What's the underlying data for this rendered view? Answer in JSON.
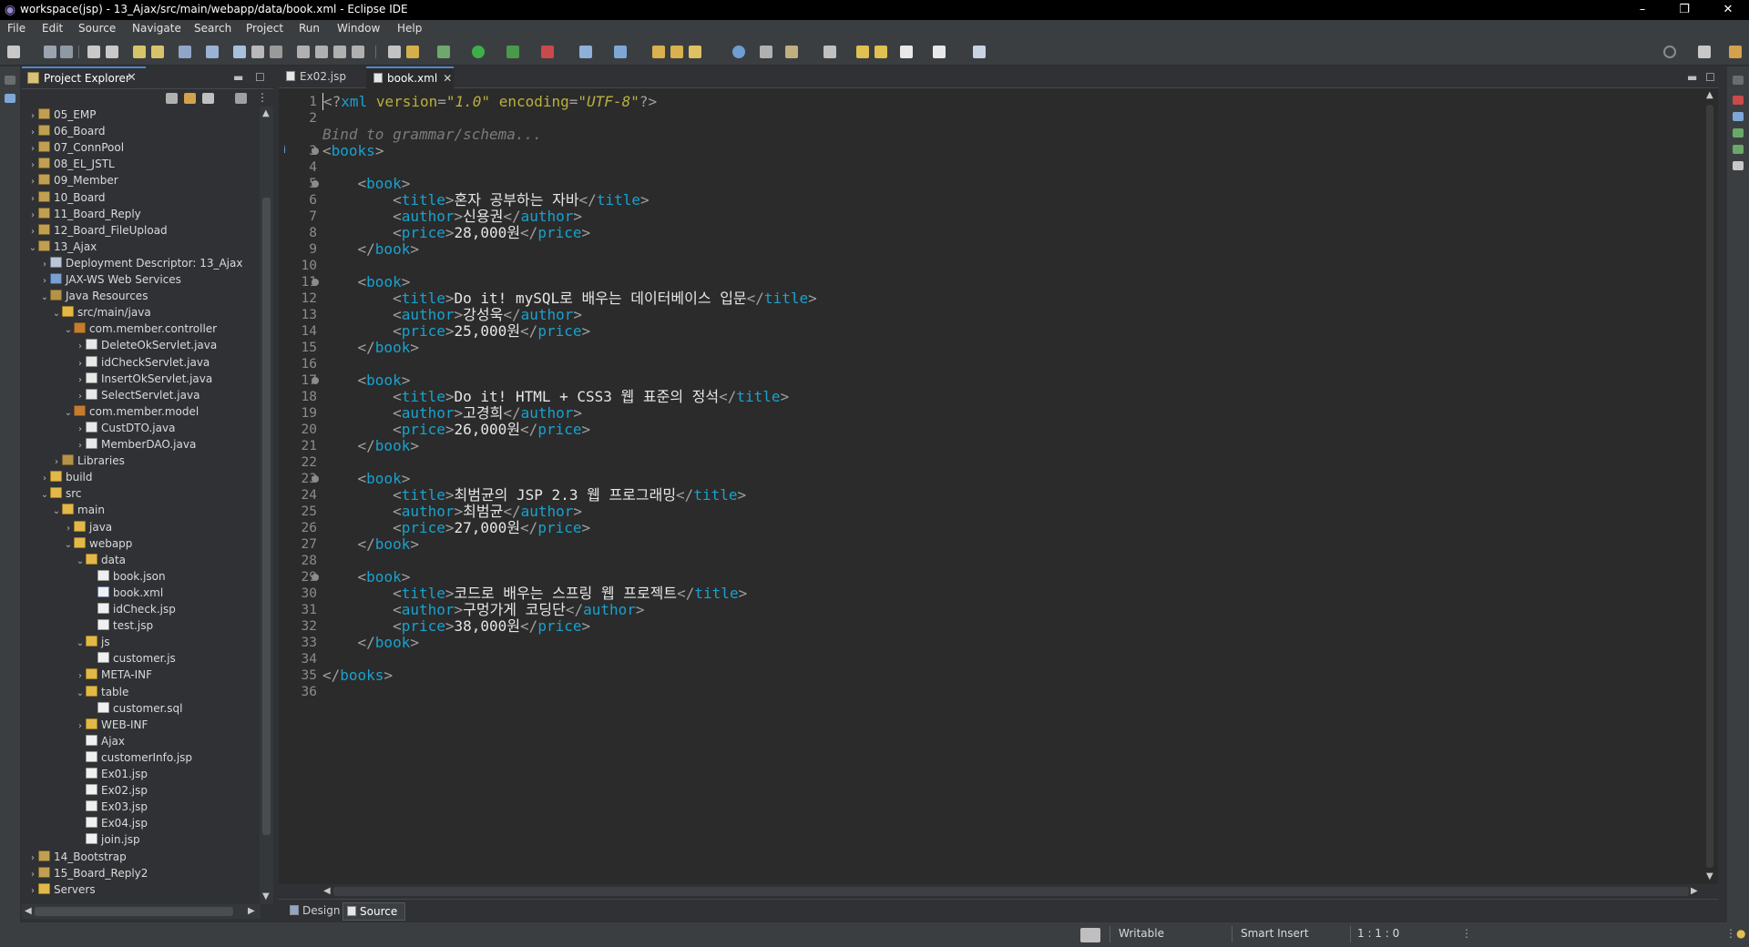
{
  "window": {
    "title": "workspace(jsp) - 13_Ajax/src/main/webapp/data/book.xml - Eclipse IDE",
    "controls": {
      "minimize": "–",
      "restore": "❐",
      "close": "✕"
    }
  },
  "menu": [
    "File",
    "Edit",
    "Source",
    "Navigate",
    "Search",
    "Project",
    "Run",
    "Window",
    "Help"
  ],
  "explorer": {
    "title": "Project Explorer",
    "close": "✕",
    "tree": [
      {
        "label": "05_EMP",
        "depth": 0,
        "arrow": "›",
        "icon": "proj"
      },
      {
        "label": "06_Board",
        "depth": 0,
        "arrow": "›",
        "icon": "proj"
      },
      {
        "label": "07_ConnPool",
        "depth": 0,
        "arrow": "›",
        "icon": "proj"
      },
      {
        "label": "08_EL_JSTL",
        "depth": 0,
        "arrow": "›",
        "icon": "proj"
      },
      {
        "label": "09_Member",
        "depth": 0,
        "arrow": "›",
        "icon": "proj"
      },
      {
        "label": "10_Board",
        "depth": 0,
        "arrow": "›",
        "icon": "proj"
      },
      {
        "label": "11_Board_Reply",
        "depth": 0,
        "arrow": "›",
        "icon": "proj"
      },
      {
        "label": "12_Board_FileUpload",
        "depth": 0,
        "arrow": "›",
        "icon": "proj"
      },
      {
        "label": "13_Ajax",
        "depth": 0,
        "arrow": "⌄",
        "icon": "proj"
      },
      {
        "label": "Deployment Descriptor: 13_Ajax",
        "depth": 1,
        "arrow": "›",
        "icon": "dd"
      },
      {
        "label": "JAX-WS Web Services",
        "depth": 1,
        "arrow": "›",
        "icon": "ws"
      },
      {
        "label": "Java Resources",
        "depth": 1,
        "arrow": "⌄",
        "icon": "lib"
      },
      {
        "label": "src/main/java",
        "depth": 2,
        "arrow": "⌄",
        "icon": "folder"
      },
      {
        "label": "com.member.controller",
        "depth": 3,
        "arrow": "⌄",
        "icon": "pkg"
      },
      {
        "label": "DeleteOkServlet.java",
        "depth": 4,
        "arrow": "›",
        "icon": "java"
      },
      {
        "label": "idCheckServlet.java",
        "depth": 4,
        "arrow": "›",
        "icon": "java"
      },
      {
        "label": "InsertOkServlet.java",
        "depth": 4,
        "arrow": "›",
        "icon": "java"
      },
      {
        "label": "SelectServlet.java",
        "depth": 4,
        "arrow": "›",
        "icon": "java"
      },
      {
        "label": "com.member.model",
        "depth": 3,
        "arrow": "⌄",
        "icon": "pkg"
      },
      {
        "label": "CustDTO.java",
        "depth": 4,
        "arrow": "›",
        "icon": "java"
      },
      {
        "label": "MemberDAO.java",
        "depth": 4,
        "arrow": "›",
        "icon": "java"
      },
      {
        "label": "Libraries",
        "depth": 2,
        "arrow": "›",
        "icon": "lib"
      },
      {
        "label": "build",
        "depth": 1,
        "arrow": "›",
        "icon": "folder"
      },
      {
        "label": "src",
        "depth": 1,
        "arrow": "⌄",
        "icon": "folder"
      },
      {
        "label": "main",
        "depth": 2,
        "arrow": "⌄",
        "icon": "folder"
      },
      {
        "label": "java",
        "depth": 3,
        "arrow": "›",
        "icon": "folder"
      },
      {
        "label": "webapp",
        "depth": 3,
        "arrow": "⌄",
        "icon": "folder"
      },
      {
        "label": "data",
        "depth": 4,
        "arrow": "⌄",
        "icon": "folder"
      },
      {
        "label": "book.json",
        "depth": 5,
        "arrow": "",
        "icon": "file"
      },
      {
        "label": "book.xml",
        "depth": 5,
        "arrow": "",
        "icon": "xml"
      },
      {
        "label": "idCheck.jsp",
        "depth": 5,
        "arrow": "",
        "icon": "file"
      },
      {
        "label": "test.jsp",
        "depth": 5,
        "arrow": "",
        "icon": "file"
      },
      {
        "label": "js",
        "depth": 4,
        "arrow": "⌄",
        "icon": "folder"
      },
      {
        "label": "customer.js",
        "depth": 5,
        "arrow": "",
        "icon": "file"
      },
      {
        "label": "META-INF",
        "depth": 4,
        "arrow": "›",
        "icon": "folder"
      },
      {
        "label": "table",
        "depth": 4,
        "arrow": "⌄",
        "icon": "folder"
      },
      {
        "label": "customer.sql",
        "depth": 5,
        "arrow": "",
        "icon": "file"
      },
      {
        "label": "WEB-INF",
        "depth": 4,
        "arrow": "›",
        "icon": "folder"
      },
      {
        "label": "Ajax",
        "depth": 4,
        "arrow": "",
        "icon": "file"
      },
      {
        "label": "customerInfo.jsp",
        "depth": 4,
        "arrow": "",
        "icon": "file"
      },
      {
        "label": "Ex01.jsp",
        "depth": 4,
        "arrow": "",
        "icon": "file"
      },
      {
        "label": "Ex02.jsp",
        "depth": 4,
        "arrow": "",
        "icon": "file"
      },
      {
        "label": "Ex03.jsp",
        "depth": 4,
        "arrow": "",
        "icon": "file"
      },
      {
        "label": "Ex04.jsp",
        "depth": 4,
        "arrow": "",
        "icon": "file"
      },
      {
        "label": "join.jsp",
        "depth": 4,
        "arrow": "",
        "icon": "file"
      },
      {
        "label": "14_Bootstrap",
        "depth": 0,
        "arrow": "›",
        "icon": "proj"
      },
      {
        "label": "15_Board_Reply2",
        "depth": 0,
        "arrow": "›",
        "icon": "proj"
      },
      {
        "label": "Servers",
        "depth": 0,
        "arrow": "›",
        "icon": "folder"
      }
    ]
  },
  "editor": {
    "tabs": [
      {
        "label": "Ex02.jsp",
        "active": false
      },
      {
        "label": "book.xml",
        "active": true,
        "close": "✕"
      }
    ],
    "hint": "Bind to grammar/schema...",
    "folded_lines": [
      3,
      5,
      11,
      17,
      23,
      29
    ],
    "lines": [
      [
        [
          "br",
          "<?"
        ],
        [
          "pi",
          "xml"
        ],
        [
          "text",
          " "
        ],
        [
          "attr",
          "version"
        ],
        [
          "br",
          "="
        ],
        [
          "val",
          "\"1.0\""
        ],
        [
          "text",
          " "
        ],
        [
          "attr",
          "encoding"
        ],
        [
          "br",
          "="
        ],
        [
          "val",
          "\"UTF-8\""
        ],
        [
          "br",
          "?>"
        ]
      ],
      [],
      [
        [
          "br",
          "<"
        ],
        [
          "tag",
          "books"
        ],
        [
          "br",
          ">"
        ]
      ],
      [],
      [
        [
          "text",
          "    "
        ],
        [
          "br",
          "<"
        ],
        [
          "tag",
          "book"
        ],
        [
          "br",
          ">"
        ]
      ],
      [
        [
          "text",
          "        "
        ],
        [
          "br",
          "<"
        ],
        [
          "tag",
          "title"
        ],
        [
          "br",
          ">"
        ],
        [
          "text",
          "혼자 공부하는 자바"
        ],
        [
          "br",
          "</"
        ],
        [
          "tag",
          "title"
        ],
        [
          "br",
          ">"
        ]
      ],
      [
        [
          "text",
          "        "
        ],
        [
          "br",
          "<"
        ],
        [
          "tag",
          "author"
        ],
        [
          "br",
          ">"
        ],
        [
          "text",
          "신용권"
        ],
        [
          "br",
          "</"
        ],
        [
          "tag",
          "author"
        ],
        [
          "br",
          ">"
        ]
      ],
      [
        [
          "text",
          "        "
        ],
        [
          "br",
          "<"
        ],
        [
          "tag",
          "price"
        ],
        [
          "br",
          ">"
        ],
        [
          "text",
          "28,000원"
        ],
        [
          "br",
          "</"
        ],
        [
          "tag",
          "price"
        ],
        [
          "br",
          ">"
        ]
      ],
      [
        [
          "text",
          "    "
        ],
        [
          "br",
          "</"
        ],
        [
          "tag",
          "book"
        ],
        [
          "br",
          ">"
        ]
      ],
      [],
      [
        [
          "text",
          "    "
        ],
        [
          "br",
          "<"
        ],
        [
          "tag",
          "book"
        ],
        [
          "br",
          ">"
        ]
      ],
      [
        [
          "text",
          "        "
        ],
        [
          "br",
          "<"
        ],
        [
          "tag",
          "title"
        ],
        [
          "br",
          ">"
        ],
        [
          "text",
          "Do it! mySQL로 배우는 데이터베이스 입문"
        ],
        [
          "br",
          "</"
        ],
        [
          "tag",
          "title"
        ],
        [
          "br",
          ">"
        ]
      ],
      [
        [
          "text",
          "        "
        ],
        [
          "br",
          "<"
        ],
        [
          "tag",
          "author"
        ],
        [
          "br",
          ">"
        ],
        [
          "text",
          "강성욱"
        ],
        [
          "br",
          "</"
        ],
        [
          "tag",
          "author"
        ],
        [
          "br",
          ">"
        ]
      ],
      [
        [
          "text",
          "        "
        ],
        [
          "br",
          "<"
        ],
        [
          "tag",
          "price"
        ],
        [
          "br",
          ">"
        ],
        [
          "text",
          "25,000원"
        ],
        [
          "br",
          "</"
        ],
        [
          "tag",
          "price"
        ],
        [
          "br",
          ">"
        ]
      ],
      [
        [
          "text",
          "    "
        ],
        [
          "br",
          "</"
        ],
        [
          "tag",
          "book"
        ],
        [
          "br",
          ">"
        ]
      ],
      [],
      [
        [
          "text",
          "    "
        ],
        [
          "br",
          "<"
        ],
        [
          "tag",
          "book"
        ],
        [
          "br",
          ">"
        ]
      ],
      [
        [
          "text",
          "        "
        ],
        [
          "br",
          "<"
        ],
        [
          "tag",
          "title"
        ],
        [
          "br",
          ">"
        ],
        [
          "text",
          "Do it! HTML + CSS3 웹 표준의 정석"
        ],
        [
          "br",
          "</"
        ],
        [
          "tag",
          "title"
        ],
        [
          "br",
          ">"
        ]
      ],
      [
        [
          "text",
          "        "
        ],
        [
          "br",
          "<"
        ],
        [
          "tag",
          "author"
        ],
        [
          "br",
          ">"
        ],
        [
          "text",
          "고경희"
        ],
        [
          "br",
          "</"
        ],
        [
          "tag",
          "author"
        ],
        [
          "br",
          ">"
        ]
      ],
      [
        [
          "text",
          "        "
        ],
        [
          "br",
          "<"
        ],
        [
          "tag",
          "price"
        ],
        [
          "br",
          ">"
        ],
        [
          "text",
          "26,000원"
        ],
        [
          "br",
          "</"
        ],
        [
          "tag",
          "price"
        ],
        [
          "br",
          ">"
        ]
      ],
      [
        [
          "text",
          "    "
        ],
        [
          "br",
          "</"
        ],
        [
          "tag",
          "book"
        ],
        [
          "br",
          ">"
        ]
      ],
      [],
      [
        [
          "text",
          "    "
        ],
        [
          "br",
          "<"
        ],
        [
          "tag",
          "book"
        ],
        [
          "br",
          ">"
        ]
      ],
      [
        [
          "text",
          "        "
        ],
        [
          "br",
          "<"
        ],
        [
          "tag",
          "title"
        ],
        [
          "br",
          ">"
        ],
        [
          "text",
          "최범균의 JSP 2.3 웹 프로그래밍"
        ],
        [
          "br",
          "</"
        ],
        [
          "tag",
          "title"
        ],
        [
          "br",
          ">"
        ]
      ],
      [
        [
          "text",
          "        "
        ],
        [
          "br",
          "<"
        ],
        [
          "tag",
          "author"
        ],
        [
          "br",
          ">"
        ],
        [
          "text",
          "최범균"
        ],
        [
          "br",
          "</"
        ],
        [
          "tag",
          "author"
        ],
        [
          "br",
          ">"
        ]
      ],
      [
        [
          "text",
          "        "
        ],
        [
          "br",
          "<"
        ],
        [
          "tag",
          "price"
        ],
        [
          "br",
          ">"
        ],
        [
          "text",
          "27,000원"
        ],
        [
          "br",
          "</"
        ],
        [
          "tag",
          "price"
        ],
        [
          "br",
          ">"
        ]
      ],
      [
        [
          "text",
          "    "
        ],
        [
          "br",
          "</"
        ],
        [
          "tag",
          "book"
        ],
        [
          "br",
          ">"
        ]
      ],
      [],
      [
        [
          "text",
          "    "
        ],
        [
          "br",
          "<"
        ],
        [
          "tag",
          "book"
        ],
        [
          "br",
          ">"
        ]
      ],
      [
        [
          "text",
          "        "
        ],
        [
          "br",
          "<"
        ],
        [
          "tag",
          "title"
        ],
        [
          "br",
          ">"
        ],
        [
          "text",
          "코드로 배우는 스프링 웹 프로젝트"
        ],
        [
          "br",
          "</"
        ],
        [
          "tag",
          "title"
        ],
        [
          "br",
          ">"
        ]
      ],
      [
        [
          "text",
          "        "
        ],
        [
          "br",
          "<"
        ],
        [
          "tag",
          "author"
        ],
        [
          "br",
          ">"
        ],
        [
          "text",
          "구멍가게 코딩단"
        ],
        [
          "br",
          "</"
        ],
        [
          "tag",
          "author"
        ],
        [
          "br",
          ">"
        ]
      ],
      [
        [
          "text",
          "        "
        ],
        [
          "br",
          "<"
        ],
        [
          "tag",
          "price"
        ],
        [
          "br",
          ">"
        ],
        [
          "text",
          "38,000원"
        ],
        [
          "br",
          "</"
        ],
        [
          "tag",
          "price"
        ],
        [
          "br",
          ">"
        ]
      ],
      [
        [
          "text",
          "    "
        ],
        [
          "br",
          "</"
        ],
        [
          "tag",
          "book"
        ],
        [
          "br",
          ">"
        ]
      ],
      [],
      [
        [
          "br",
          "</"
        ],
        [
          "tag",
          "books"
        ],
        [
          "br",
          ">"
        ]
      ],
      []
    ],
    "bottom_tabs": [
      {
        "label": "Design",
        "active": false
      },
      {
        "label": "Source",
        "active": true
      }
    ]
  },
  "status": {
    "writable": "Writable",
    "insert_mode": "Smart Insert",
    "position": "1 : 1 : 0"
  },
  "colors": {
    "tag": "#18a2cf",
    "attribute": "#b9b03f",
    "bracket": "#a0a0a0",
    "text": "#e6e6e6",
    "accent": "#4f86c6"
  }
}
